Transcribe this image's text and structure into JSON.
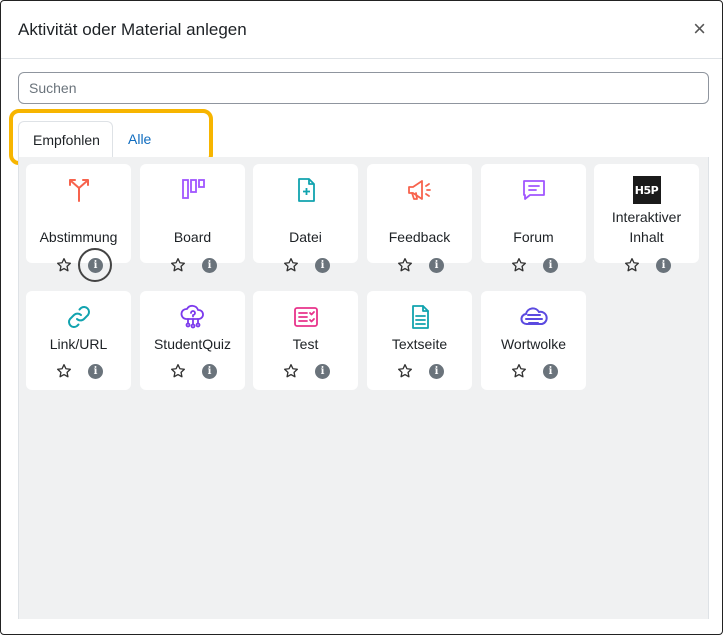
{
  "dialog": {
    "title": "Aktivität oder Material anlegen",
    "close_glyph": "×"
  },
  "search": {
    "placeholder": "Suchen",
    "value": ""
  },
  "tabs": [
    {
      "label": "Empfohlen",
      "active": true
    },
    {
      "label": "Alle",
      "active": false
    }
  ],
  "colors": {
    "highlight": "#f7b500",
    "link": "#0f6cbf",
    "info_badge": "#6a737b",
    "panel_bg": "#f0f1f2"
  },
  "items": [
    {
      "label": "Abstimmung",
      "icon": "choice-icon",
      "icon_color": "#f7634d"
    },
    {
      "label": "Board",
      "icon": "board-icon",
      "icon_color": "#a056ff"
    },
    {
      "label": "Datei",
      "icon": "file-plus-icon",
      "icon_color": "#11a3af"
    },
    {
      "label": "Feedback",
      "icon": "megaphone-icon",
      "icon_color": "#f7634d"
    },
    {
      "label": "Forum",
      "icon": "forum-icon",
      "icon_color": "#a056ff"
    },
    {
      "label": "Interaktiver Inhalt",
      "icon": "h5p-icon",
      "icon_text": "H5P",
      "icon_color": "#1a1a1a"
    },
    {
      "label": "Link/URL",
      "icon": "link-icon",
      "icon_color": "#11a3af"
    },
    {
      "label": "StudentQuiz",
      "icon": "studentquiz-icon",
      "icon_color": "#7c3aed"
    },
    {
      "label": "Test",
      "icon": "quiz-icon",
      "icon_color": "#e8338b"
    },
    {
      "label": "Textseite",
      "icon": "page-icon",
      "icon_color": "#11a3af"
    },
    {
      "label": "Wortwolke",
      "icon": "wordcloud-icon",
      "icon_color": "#5b4ae0"
    }
  ],
  "info_glyph": "i"
}
